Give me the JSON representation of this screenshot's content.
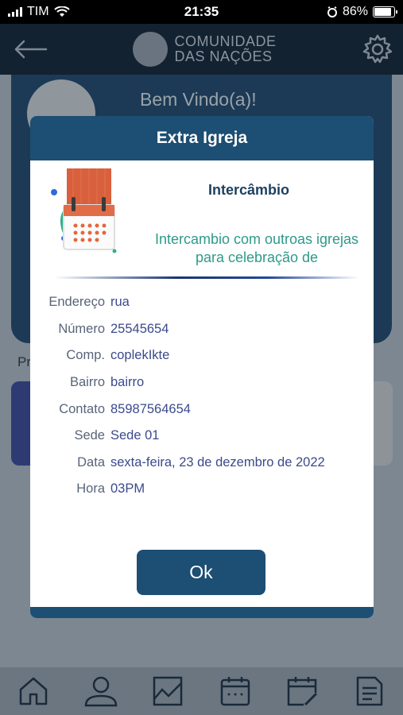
{
  "status_bar": {
    "carrier": "TIM",
    "time": "21:35",
    "battery": "86%",
    "battery_level": 0.86
  },
  "header": {
    "logo_line1": "COMUNIDADE",
    "logo_line2": "DAS NAÇÕES",
    "back_icon": "back-arrow-icon",
    "settings_icon": "gear-icon"
  },
  "background": {
    "welcome": "Bem Vindo(a)!",
    "section_fragment": "Pr"
  },
  "modal": {
    "title": "Extra Igreja",
    "event_title": "Intercâmbio",
    "event_desc": "Intercambio com outroas igrejas para celebração de",
    "details": [
      {
        "label": "Endereço",
        "value": "rua"
      },
      {
        "label": "Número",
        "value": "25545654"
      },
      {
        "label": "Comp.",
        "value": "coplekIkte"
      },
      {
        "label": "Bairro",
        "value": "bairro"
      },
      {
        "label": "Contato",
        "value": "85987564654"
      },
      {
        "label": "Sede",
        "value": "Sede 01"
      },
      {
        "label": "Data",
        "value": "sexta-feira, 23 de dezembro de 2022"
      },
      {
        "label": "Hora",
        "value": "03PM"
      }
    ],
    "ok_label": "Ok"
  },
  "bottom_nav": [
    "home-icon",
    "profile-icon",
    "chart-icon",
    "calendar-icon",
    "calendar-edit-icon",
    "document-icon"
  ],
  "colors": {
    "primary": "#1d4e73",
    "accent_teal": "#2e9a8a",
    "value_text": "#3b4a8c"
  }
}
